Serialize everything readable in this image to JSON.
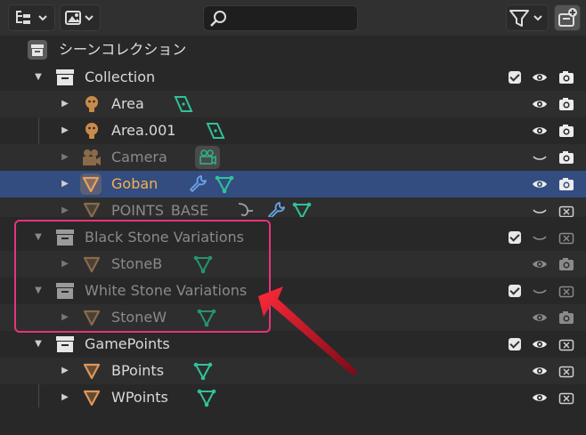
{
  "header": {
    "search": {
      "value": "",
      "placeholder": ""
    },
    "icons": [
      "outliner-display-mode-icon",
      "filter-view-icon",
      "search-icon",
      "funnel-icon",
      "new-collection-icon"
    ]
  },
  "scene_collection": {
    "label": "シーンコレクション"
  },
  "rows": [
    {
      "label": "Collection",
      "type": "collection"
    },
    {
      "label": "Area",
      "type": "light"
    },
    {
      "label": "Area.001",
      "type": "light"
    },
    {
      "label": "Camera",
      "type": "camera",
      "dimmed": true
    },
    {
      "label": "Goban",
      "type": "mesh",
      "selected": true
    },
    {
      "label": "POINTS_BASE",
      "type": "mesh",
      "dimmed": true
    },
    {
      "label": "Black Stone Variations",
      "type": "collection",
      "dimmed": true
    },
    {
      "label": "StoneB",
      "type": "mesh",
      "dimmed": true
    },
    {
      "label": "White Stone Variations",
      "type": "collection",
      "dimmed": true
    },
    {
      "label": "StoneW",
      "type": "mesh",
      "dimmed": true
    },
    {
      "label": "GamePoints",
      "type": "collection"
    },
    {
      "label": "BPoints",
      "type": "mesh"
    },
    {
      "label": "WPoints",
      "type": "mesh"
    }
  ],
  "colors": {
    "background": "#282828",
    "selection": "#334d80",
    "selected_text": "#f5b14a",
    "highlight_box": "#e8337a",
    "arrow": "#e0102a",
    "mesh_icon": "#c98a4b",
    "data_icon": "#2fc39a",
    "modifier_icon": "#6aa3e8"
  }
}
